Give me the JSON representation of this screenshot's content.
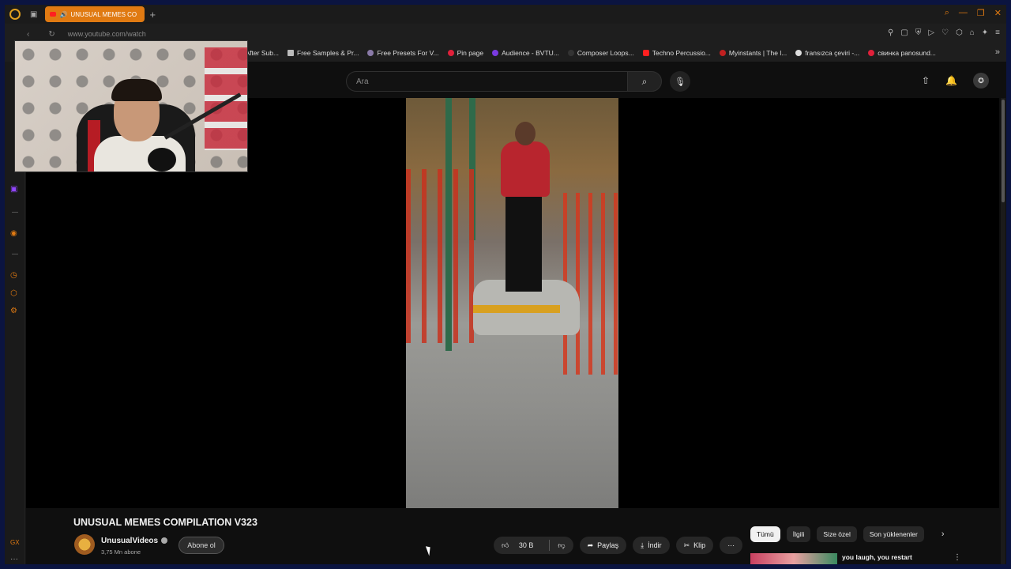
{
  "browser": {
    "active_tab_title": "UNUSUAL MEMES CO",
    "url": "www.youtube.com/watch",
    "bookmarks": [
      "le After Sub...",
      "Free Samples & Pr...",
      "Free Presets For V...",
      "Pin page",
      "Audience - BVTU...",
      "Composer Loops...",
      "Techno Percussio...",
      "Myinstants | The l...",
      "fransızca çeviri -...",
      "свинка panosund..."
    ]
  },
  "header": {
    "search_placeholder": "Ara"
  },
  "video": {
    "title": "UNUSUAL MEMES COMPILATION V323",
    "channel_name": "UnusualVideos",
    "subscribers": "3,75 Mn abone",
    "subscribe_label": "Abone ol",
    "like_count": "30 B",
    "share_label": "Paylaş",
    "download_label": "İndir",
    "clip_label": "Klip",
    "more_label": "···"
  },
  "recommendations": {
    "chips": [
      "Tümü",
      "İlgili",
      "Size özel",
      "Son yüklenenler"
    ],
    "first_title": "you laugh, you restart"
  },
  "colors": {
    "accent": "#e07a12",
    "youtube_red": "#ff0000",
    "page_bg": "#0f0f0f"
  }
}
